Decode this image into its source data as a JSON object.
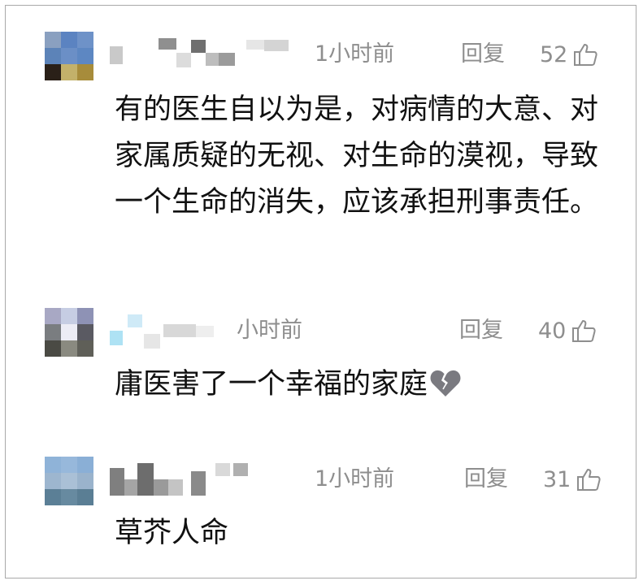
{
  "comments": [
    {
      "time": "1小时前",
      "reply_label": "回复",
      "likes": "52",
      "text": "有的医生自以为是，对病情的大意、对家属质疑的无视、对生命的漠视，导致一个生命的消失，应该承担刑事责任。",
      "avatar_colors": [
        "#8aa0c0",
        "#5b83c1",
        "#6e92c8",
        "#5c83b8",
        "#6b8fc6",
        "#5d87c2",
        "#2a2018",
        "#c3b16a",
        "#a78c3b"
      ],
      "name_colors": [
        "#c9c9c9",
        "#8f8f8f",
        "#dcdcdc",
        "#6f6f6f",
        "#bdbdbd",
        "#9b9b9b",
        "#e6e6e6",
        "#d4d4d4"
      ]
    },
    {
      "time": "小时前",
      "reply_label": "回复",
      "likes": "40",
      "text": "庸医害了一个幸福的家庭",
      "text_icon": "broken-heart-icon",
      "avatar_colors": [
        "#a8a8c4",
        "#c6cde3",
        "#8e92b5",
        "#7a7d80",
        "#ececf5",
        "#5a5a62",
        "#4a4a44",
        "#8a8a80",
        "#5f5f58"
      ],
      "name_colors": [
        "#cfeaf7",
        "#aee2f4",
        "#e6e6e6",
        "#d8d8d8",
        "#eeeeee"
      ]
    },
    {
      "time": "1小时前",
      "reply_label": "回复",
      "likes": "31",
      "text": "草芥人命",
      "avatar_colors": [
        "#8fb3d8",
        "#97b8db",
        "#8aafd6",
        "#9db6cf",
        "#aac0d6",
        "#9ab3cc",
        "#5b7f96",
        "#678aa0",
        "#5a7e94"
      ],
      "name_colors": [
        "#7f7f7f",
        "#a5a5a5",
        "#6d6d6d",
        "#9a9a9a",
        "#c4c4c4",
        "#8a8a8a",
        "#d9d9d9",
        "#b0b0b0"
      ]
    }
  ],
  "colors": {
    "meta": "#8e8e8e",
    "text": "#111111",
    "border": "#a9a9a9"
  }
}
